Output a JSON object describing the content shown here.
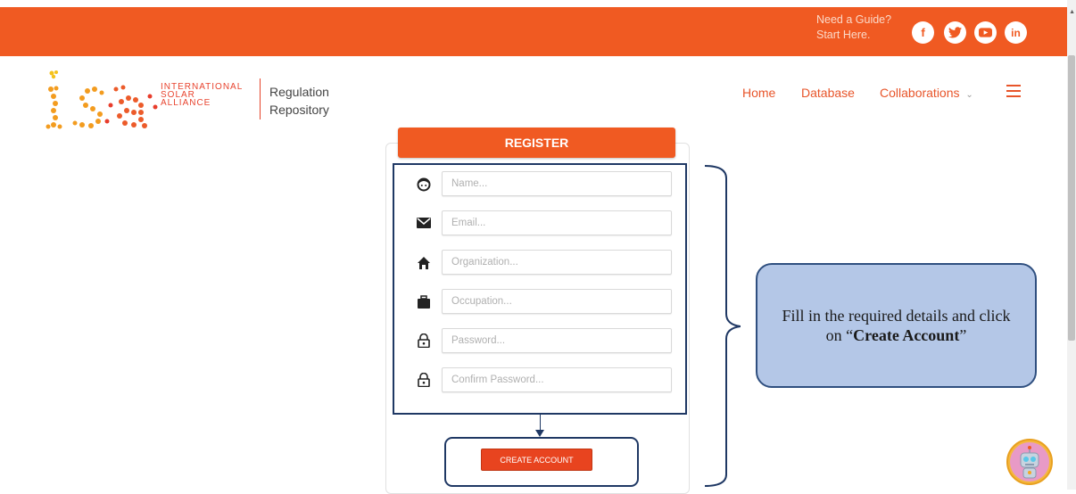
{
  "header": {
    "guide_line1": "Need a Guide?",
    "guide_line2": "Start Here.",
    "social": [
      {
        "icon": "facebook-icon",
        "glyph": "f"
      },
      {
        "icon": "twitter-icon",
        "glyph": "t"
      },
      {
        "icon": "youtube-icon",
        "glyph": "▶"
      },
      {
        "icon": "linkedin-icon",
        "glyph": "in"
      }
    ]
  },
  "brand": {
    "logo_text": "isa",
    "line1": "INTERNATIONAL",
    "line2": "SOLAR",
    "line3": "ALLIANCE",
    "subtitle_line1": "Regulation",
    "subtitle_line2": "Repository"
  },
  "nav": {
    "home": "Home",
    "database": "Database",
    "collaborations": "Collaborations"
  },
  "form": {
    "title": "REGISTER",
    "fields": [
      {
        "placeholder": "Name...",
        "icon": "face-icon"
      },
      {
        "placeholder": "Email...",
        "icon": "envelope-icon"
      },
      {
        "placeholder": "Organization...",
        "icon": "home-icon"
      },
      {
        "placeholder": "Occupation...",
        "icon": "briefcase-icon"
      },
      {
        "placeholder": "Password...",
        "icon": "lock-icon"
      },
      {
        "placeholder": "Confirm Password...",
        "icon": "lock-icon"
      }
    ],
    "submit": "CREATE ACCOUNT"
  },
  "callout": {
    "text_before": "Fill in the required details and click on “",
    "text_bold": "Create Account",
    "text_after": "”"
  },
  "colors": {
    "brand_orange": "#f05a22",
    "annotation_navy": "#1f3864",
    "callout_fill": "#b4c7e7"
  }
}
